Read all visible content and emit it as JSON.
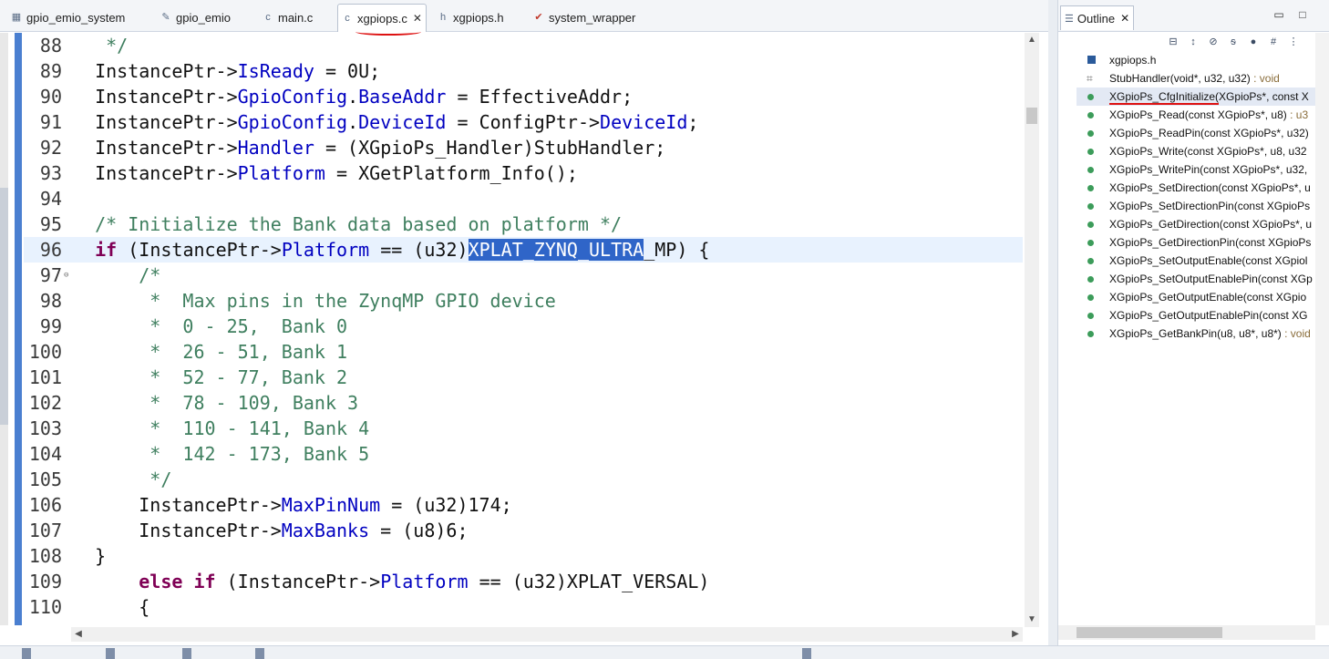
{
  "editor": {
    "tabs": [
      {
        "label": "gpio_emio_system",
        "icon": "project-icon"
      },
      {
        "label": "gpio_emio",
        "icon": "tools-icon"
      },
      {
        "label": "main.c",
        "icon": "c-file-icon"
      },
      {
        "label": "xgpiops.c",
        "icon": "c-file-icon",
        "active": true,
        "close": "✕"
      },
      {
        "label": "xgpiops.h",
        "icon": "h-file-icon"
      },
      {
        "label": "system_wrapper",
        "icon": "hdl-icon"
      }
    ],
    "lines": [
      {
        "n": "88",
        "text": "   */"
      },
      {
        "n": "89",
        "text": "  InstancePtr->IsReady = 0U;"
      },
      {
        "n": "90",
        "text": "  InstancePtr->GpioConfig.BaseAddr = EffectiveAddr;"
      },
      {
        "n": "91",
        "text": "  InstancePtr->GpioConfig.DeviceId = ConfigPtr->DeviceId;"
      },
      {
        "n": "92",
        "text": "  InstancePtr->Handler = (XGpioPs_Handler)StubHandler;"
      },
      {
        "n": "93",
        "text": "  InstancePtr->Platform = XGetPlatform_Info();"
      },
      {
        "n": "94",
        "text": ""
      },
      {
        "n": "95",
        "text": "  /* Initialize the Bank data based on platform */"
      },
      {
        "n": "96",
        "text": "  if (InstancePtr->Platform == (u32)XPLAT_ZYNQ_ULTRA_MP) {"
      },
      {
        "n": "97",
        "text": "      /*"
      },
      {
        "n": "98",
        "text": "       *  Max pins in the ZynqMP GPIO device"
      },
      {
        "n": "99",
        "text": "       *  0 - 25,  Bank 0"
      },
      {
        "n": "100",
        "text": "       *  26 - 51, Bank 1"
      },
      {
        "n": "101",
        "text": "       *  52 - 77, Bank 2"
      },
      {
        "n": "102",
        "text": "       *  78 - 109, Bank 3"
      },
      {
        "n": "103",
        "text": "       *  110 - 141, Bank 4"
      },
      {
        "n": "104",
        "text": "       *  142 - 173, Bank 5"
      },
      {
        "n": "105",
        "text": "       */"
      },
      {
        "n": "106",
        "text": "      InstancePtr->MaxPinNum = (u32)174;"
      },
      {
        "n": "107",
        "text": "      InstancePtr->MaxBanks = (u8)6;"
      },
      {
        "n": "108",
        "text": "  }"
      },
      {
        "n": "109",
        "text": "      else if (InstancePtr->Platform == (u32)XPLAT_VERSAL)"
      },
      {
        "n": "110",
        "text": "      {"
      }
    ]
  },
  "outline": {
    "tab_label": "Outline",
    "close": "✕",
    "items": [
      {
        "label": "xgpiops.h",
        "type": "",
        "icon": "header-icon"
      },
      {
        "label": "StubHandler(void*, u32, u32)",
        "type": " : void",
        "icon": "stub-icon"
      },
      {
        "label": "XGpioPs_CfgInitialize(XGpioPs*, const X",
        "type": "",
        "icon": "function-icon",
        "selected": true
      },
      {
        "label": "XGpioPs_Read(const XGpioPs*, u8)",
        "type": " : u3",
        "icon": "function-icon"
      },
      {
        "label": "XGpioPs_ReadPin(const XGpioPs*, u32)",
        "type": "",
        "icon": "function-icon"
      },
      {
        "label": "XGpioPs_Write(const XGpioPs*, u8, u32",
        "type": "",
        "icon": "function-icon"
      },
      {
        "label": "XGpioPs_WritePin(const XGpioPs*, u32,",
        "type": "",
        "icon": "function-icon"
      },
      {
        "label": "XGpioPs_SetDirection(const XGpioPs*, u",
        "type": "",
        "icon": "function-icon"
      },
      {
        "label": "XGpioPs_SetDirectionPin(const XGpioPs",
        "type": "",
        "icon": "function-icon"
      },
      {
        "label": "XGpioPs_GetDirection(const XGpioPs*, u",
        "type": "",
        "icon": "function-icon"
      },
      {
        "label": "XGpioPs_GetDirectionPin(const XGpioPs",
        "type": "",
        "icon": "function-icon"
      },
      {
        "label": "XGpioPs_SetOutputEnable(const XGpiol",
        "type": "",
        "icon": "function-icon"
      },
      {
        "label": "XGpioPs_SetOutputEnablePin(const XGp",
        "type": "",
        "icon": "function-icon"
      },
      {
        "label": "XGpioPs_GetOutputEnable(const XGpio",
        "type": "",
        "icon": "function-icon"
      },
      {
        "label": "XGpioPs_GetOutputEnablePin(const XG",
        "type": "",
        "icon": "function-icon"
      },
      {
        "label": "XGpioPs_GetBankPin(u8, u8*, u8*)",
        "type": " : void",
        "icon": "function-icon"
      }
    ]
  },
  "colors": {
    "keyword": "#7f0055",
    "field": "#0000c0",
    "comment": "#3f7f5f",
    "selection": "#2f65c8"
  }
}
